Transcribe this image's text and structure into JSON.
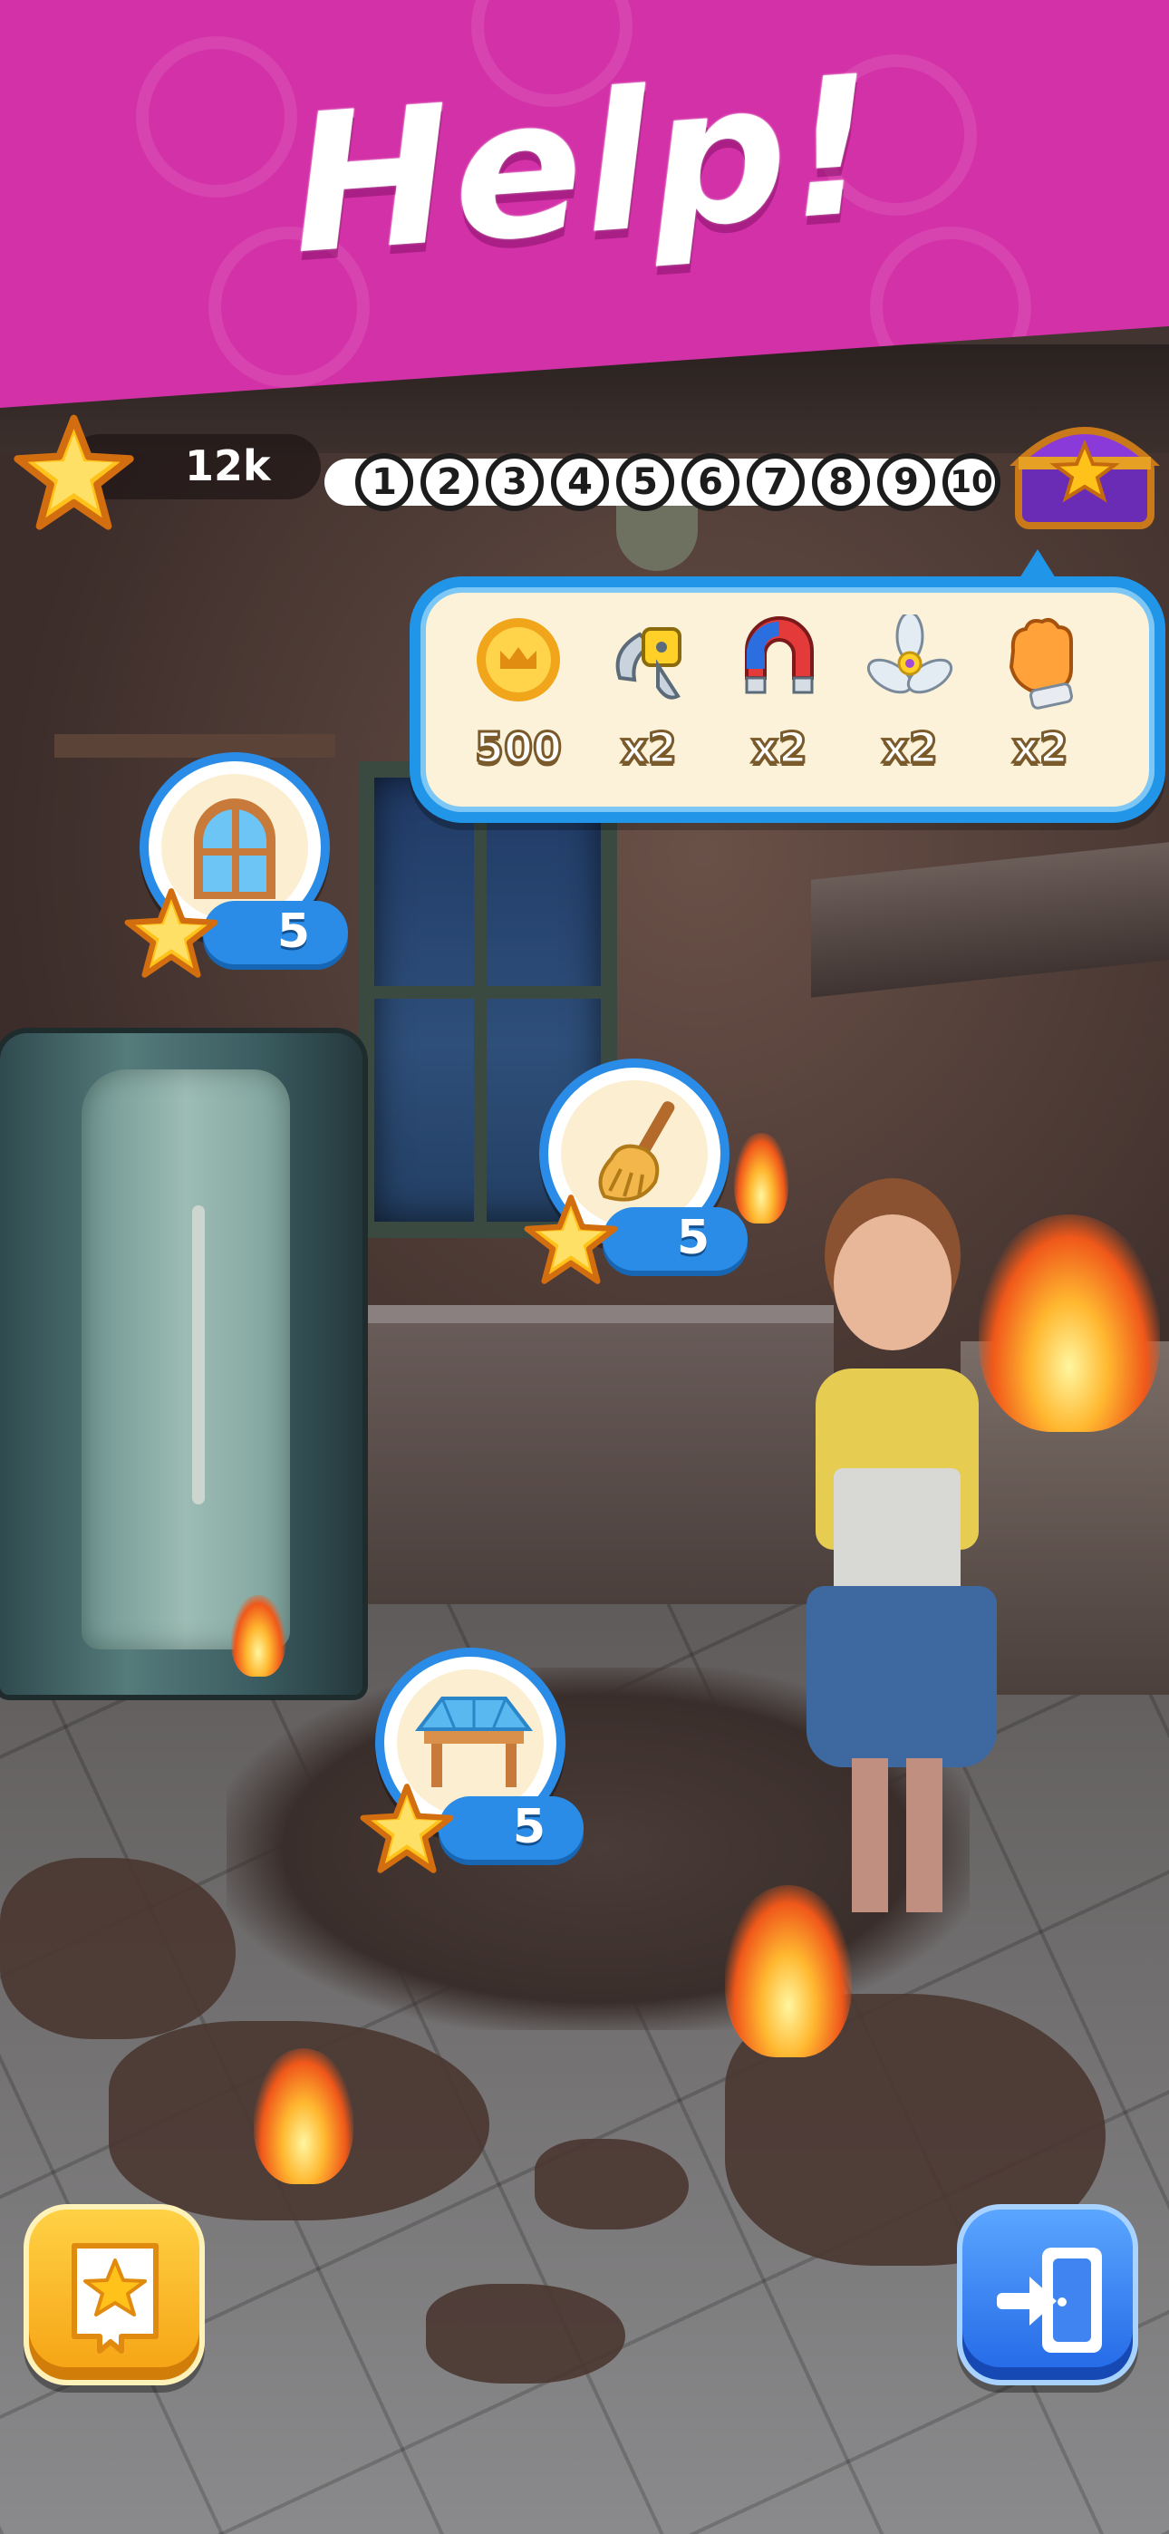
{
  "banner": {
    "title": "Help!"
  },
  "hud": {
    "stars_value": "12k",
    "levels": [
      "1",
      "2",
      "3",
      "4",
      "5",
      "6",
      "7",
      "8",
      "9",
      "10"
    ],
    "chest_icon": "treasure-chest-icon"
  },
  "rewards": {
    "items": [
      {
        "icon": "coin-icon",
        "label": "500"
      },
      {
        "icon": "hammer-icon",
        "label": "x2"
      },
      {
        "icon": "magnet-icon",
        "label": "x2"
      },
      {
        "icon": "propeller-icon",
        "label": "x2"
      },
      {
        "icon": "glove-icon",
        "label": "x2"
      }
    ]
  },
  "tasks": [
    {
      "name": "window",
      "icon": "window-icon",
      "cost": "5"
    },
    {
      "name": "broom",
      "icon": "broom-icon",
      "cost": "5"
    },
    {
      "name": "table",
      "icon": "table-icon",
      "cost": "5"
    }
  ],
  "buttons": {
    "collection_icon": "star-book-icon",
    "exit_icon": "exit-door-icon"
  },
  "colors": {
    "banner": "#d331a8",
    "accent_blue": "#2196e8",
    "star": "#ffc21a",
    "collection_button": "#f5a212",
    "exit_button": "#2267e6"
  }
}
